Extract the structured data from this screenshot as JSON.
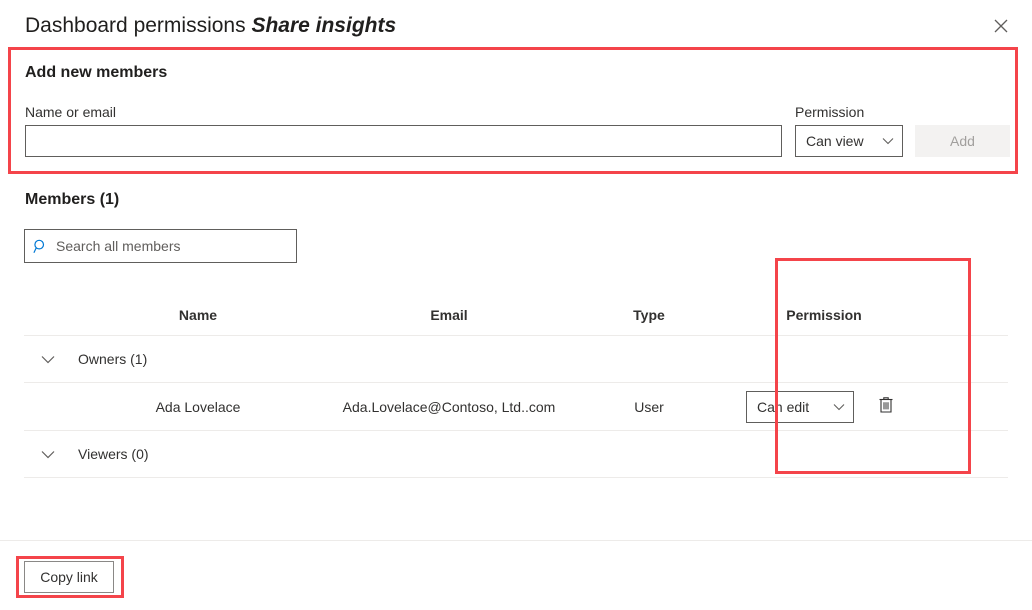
{
  "dialog": {
    "title_main": "Dashboard permissions ",
    "title_subject": "Share insights",
    "close_icon": "close-icon",
    "close_label": "Close"
  },
  "add_members": {
    "heading": "Add new members",
    "name_label": "Name or email",
    "name_value": "",
    "name_placeholder": "",
    "permission_label": "Permission",
    "permission_value": "Can view",
    "permission_options": [
      "Can view",
      "Can edit"
    ],
    "add_button": "Add",
    "add_button_disabled": true
  },
  "members": {
    "heading": "Members (1)",
    "search_placeholder": "Search all members",
    "search_value": "",
    "search_icon": "search-icon",
    "columns": {
      "name": "Name",
      "email": "Email",
      "type": "Type",
      "permission": "Permission"
    },
    "groups": [
      {
        "label": "Owners (1)",
        "expanded": true,
        "chevron_icon": "chevron-down-icon",
        "rows": [
          {
            "name": "Ada Lovelace",
            "email": "Ada.Lovelace@Contoso, Ltd..com",
            "type": "User",
            "permission": "Can edit",
            "permission_options": [
              "Can view",
              "Can edit"
            ],
            "delete_icon": "trash-icon"
          }
        ]
      },
      {
        "label": "Viewers (0)",
        "expanded": true,
        "chevron_icon": "chevron-down-icon",
        "rows": []
      }
    ]
  },
  "footer": {
    "copy_link_label": "Copy link"
  },
  "colors": {
    "annotation_red": "#f4444a",
    "accent_blue": "#0078d4",
    "text_primary": "#323130",
    "text_disabled": "#a19f9d",
    "border": "#605e5c",
    "divider": "#edebe9",
    "disabled_bg": "#f3f2f1"
  }
}
